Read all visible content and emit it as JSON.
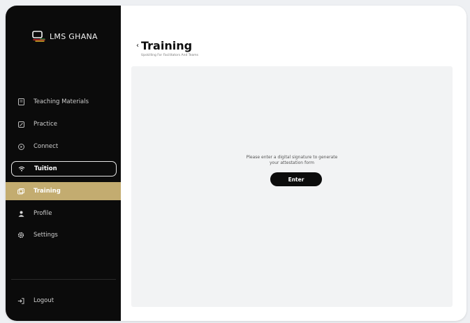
{
  "app": {
    "logo_text": "LMS GHANA",
    "brand_colors": {
      "sidebar_bg": "#0b0b0b",
      "accent_gold": "#c3ac70",
      "button_dark": "#0c0c0c"
    }
  },
  "sidebar": {
    "items": [
      {
        "label": "Teaching Materials",
        "icon": "book-icon"
      },
      {
        "label": "Practice",
        "icon": "pencil-icon"
      },
      {
        "label": "Connect",
        "icon": "play-icon"
      },
      {
        "label": "Tuition",
        "icon": "wifi-icon",
        "state": "outlined"
      },
      {
        "label": "Training",
        "icon": "training-icon",
        "state": "active"
      },
      {
        "label": "Profile",
        "icon": "user-icon"
      },
      {
        "label": "Settings",
        "icon": "gear-icon"
      }
    ],
    "logout": {
      "label": "Logout",
      "icon": "logout-icon"
    }
  },
  "header": {
    "back_icon": "chevron-left-icon",
    "title": "Training",
    "subtitle": "Upskilling For Facilitators And Teams"
  },
  "main": {
    "prompt_line1": "Please enter a digital signature to generate",
    "prompt_line2": "your attestation form",
    "enter_button": "Enter"
  }
}
